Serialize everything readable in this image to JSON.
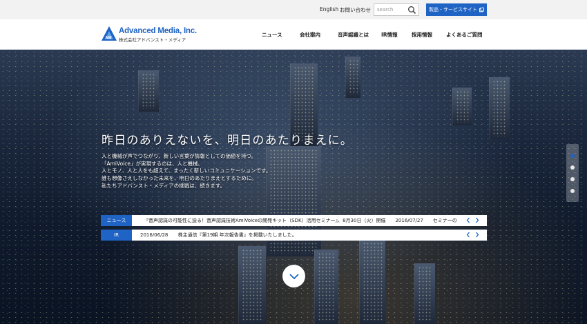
{
  "topbar": {
    "english_label": "English",
    "contact_label": "お問い合わせ",
    "search_placeholder": "search",
    "products_label": "製品・サービスサイト"
  },
  "header": {
    "logo_name": "Advanced Media, Inc.",
    "logo_sub": "株式会社アドバンスト・メディア",
    "nav": [
      "ニュース",
      "会社案内",
      "音声認識とは",
      "IR情報",
      "採用情報",
      "よくあるご質問"
    ]
  },
  "hero": {
    "headline": "昨日のありえないを、明日のあたりまえに。",
    "body": [
      "人と機械が声でつながり、新しい言葉が情報としての価値を持つ。",
      "「AmiVoice」が実現するのは、人と機械、",
      "人とモノ、人と人をも超えて、まったく新しいコミュニケーションです。",
      "誰も想像さえしなかった未来を、明日のあたりまえとするために。",
      "私たちアドバンスト・メディアの挑戦は、続きます。"
    ],
    "slide_count": 4,
    "active_slide": 1
  },
  "tickers": [
    {
      "label": "ニュース",
      "date": "",
      "text": "『音声認識の可能性に迫る！音声認識技術AmiVoiceの開発キット（SDK）活用セミナー』、8月30日（火）開催　　2016/07/27　　セミナーの"
    },
    {
      "label": "IR",
      "date": "2016/06/28",
      "text": "株主通信『第19期 年次報告書』を掲載いたしました。"
    }
  ],
  "colors": {
    "brand_blue": "#1f63c4",
    "topbar_bg": "#f2f2f2"
  },
  "icons": {
    "search": "search-icon",
    "external": "external-link-icon",
    "prev": "chevron-left-icon",
    "next": "chevron-right-icon",
    "scroll": "chevron-down-icon"
  }
}
